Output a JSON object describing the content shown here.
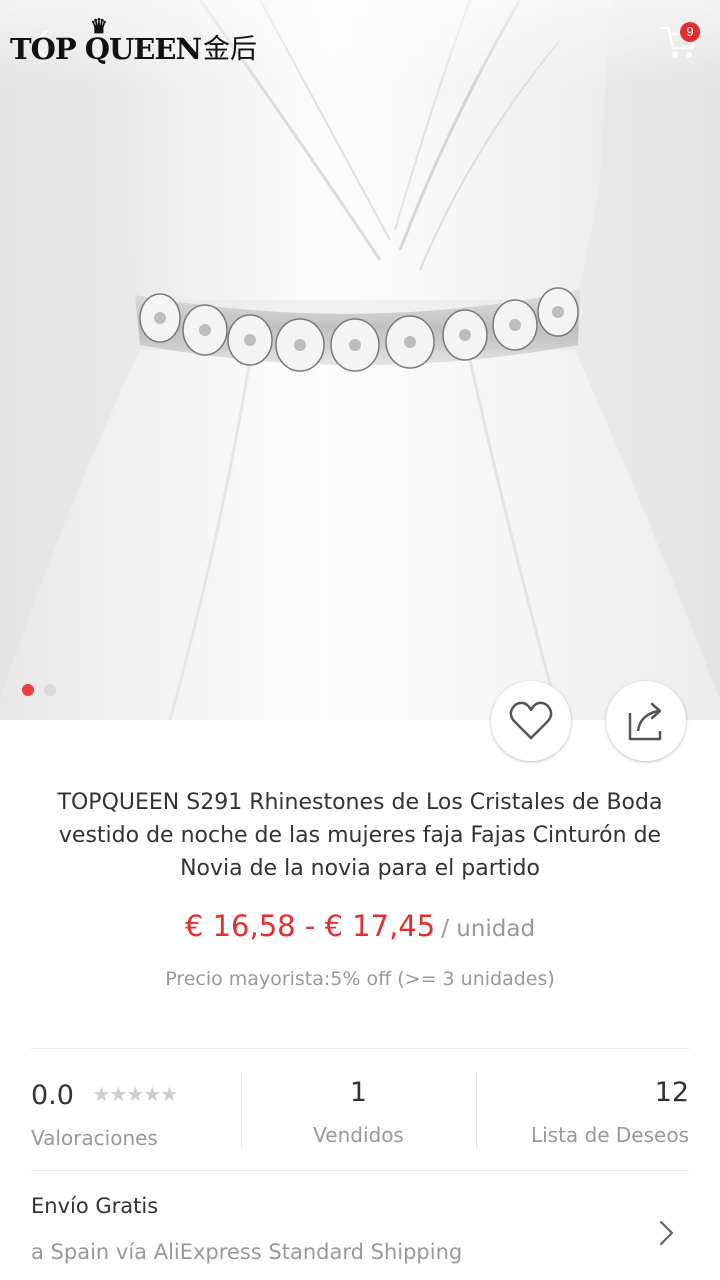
{
  "header": {
    "brand_latin": "TOP QUEEN",
    "brand_cjk": "金后",
    "cart_count": "9"
  },
  "gallery": {
    "image_count": 2,
    "active_index": 0
  },
  "product": {
    "title": "TOPQUEEN S291 Rhinestones de Los Cristales de Boda vestido de noche de las mujeres faja Fajas Cinturón de Novia de la novia para el partido",
    "price": "€ 16,58 - € 17,45",
    "price_unit": "/ unidad",
    "wholesale": "Precio mayorista:5% off (>= 3 unidades)"
  },
  "stats": {
    "rating_value": "0.0",
    "rating_label": "Valoraciones",
    "rating_stars": 0,
    "sold_value": "1",
    "sold_label": "Vendidos",
    "wishlist_value": "12",
    "wishlist_label": "Lista de Deseos"
  },
  "shipping": {
    "title": "Envío Gratis",
    "detail": "a Spain vía AliExpress Standard Shipping"
  },
  "icons": {
    "back": "back-arrow-icon",
    "cart": "cart-icon",
    "wishlist": "heart-icon",
    "share": "share-icon",
    "chevron": "chevron-right-icon"
  },
  "colors": {
    "accent": "#e62e2e",
    "muted": "#999999",
    "divider": "#e6e6e6"
  }
}
